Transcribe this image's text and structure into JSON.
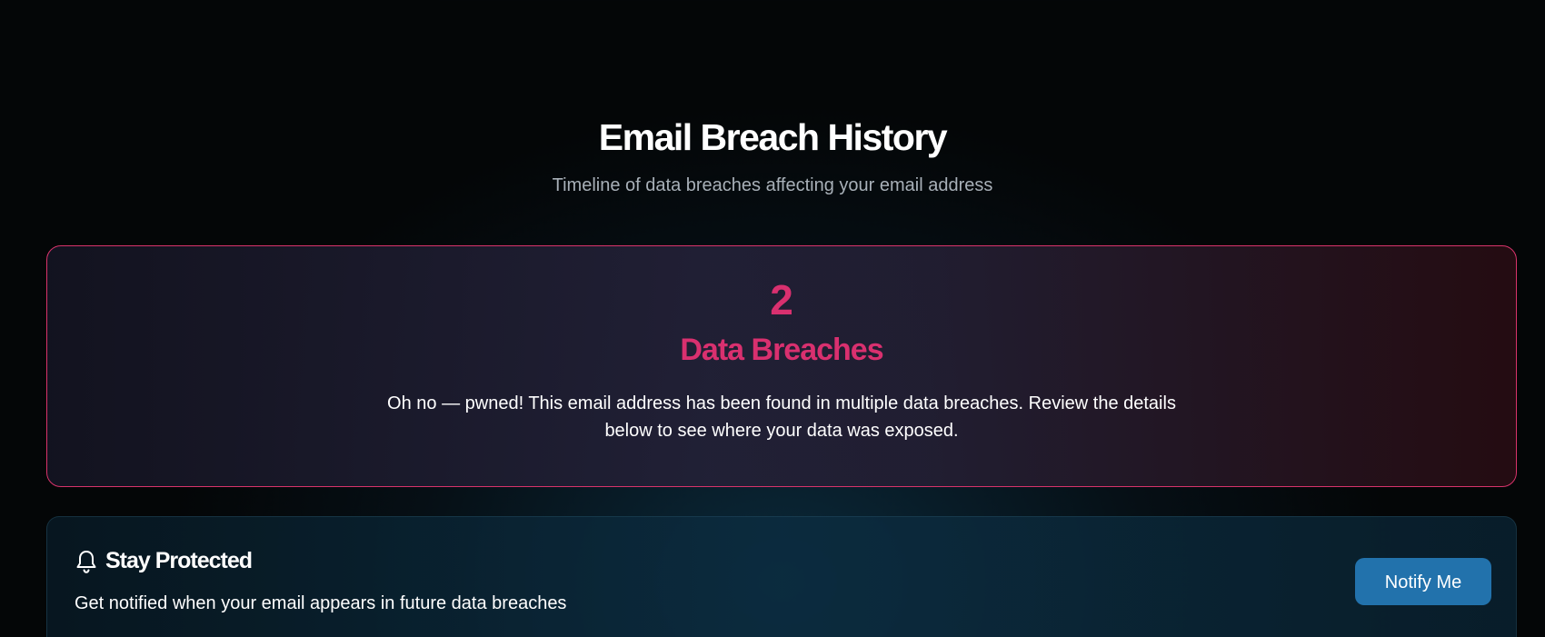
{
  "header": {
    "title": "Email Breach History",
    "subtitle": "Timeline of data breaches affecting your email address"
  },
  "summary": {
    "count": "2",
    "label": "Data Breaches",
    "message": "Oh no — pwned! This email address has been found in multiple data breaches. Review the details below to see where your data was exposed."
  },
  "protect": {
    "icon": "bell-icon",
    "title": "Stay Protected",
    "description": "Get notified when your email appears in future data breaches",
    "button_label": "Notify Me"
  },
  "colors": {
    "accent": "#d9306f",
    "button": "#2272ac",
    "background": "#040607"
  }
}
